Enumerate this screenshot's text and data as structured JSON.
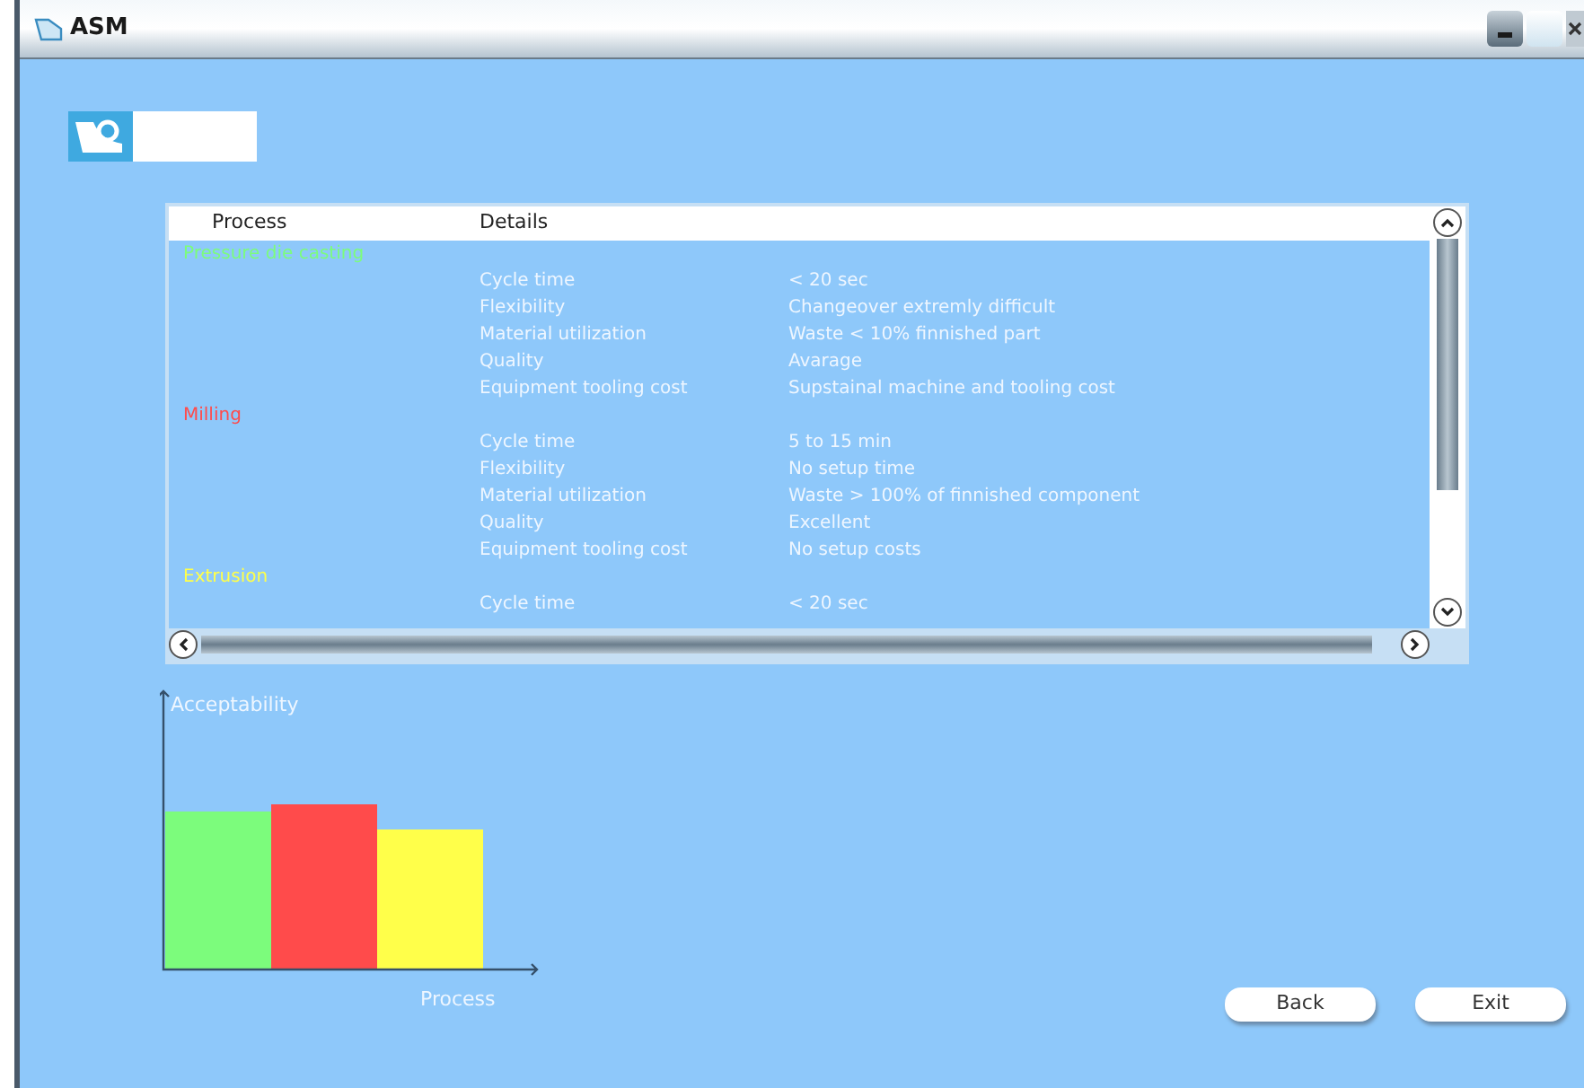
{
  "window": {
    "title": "ASM"
  },
  "table": {
    "columns": [
      "Process",
      "Details"
    ],
    "processes": [
      {
        "name": "Pressure die casting",
        "color": "#7cfc7c",
        "details": [
          {
            "label": "Cycle time",
            "value": "< 20 sec"
          },
          {
            "label": "Flexibility",
            "value": "Changeover extremly difficult"
          },
          {
            "label": "Material utilization",
            "value": "Waste < 10% finnished part"
          },
          {
            "label": "Quality",
            "value": "Avarage"
          },
          {
            "label": "Equipment tooling cost",
            "value": "Supstainal machine and tooling cost"
          }
        ]
      },
      {
        "name": "Milling",
        "color": "#ff4b4b",
        "details": [
          {
            "label": "Cycle time",
            "value": "5 to 15 min"
          },
          {
            "label": "Flexibility",
            "value": "No setup time"
          },
          {
            "label": "Material utilization",
            "value": "Waste > 100% of finnished component"
          },
          {
            "label": "Quality",
            "value": "Excellent"
          },
          {
            "label": "Equipment tooling cost",
            "value": "No setup costs"
          }
        ]
      },
      {
        "name": "Extrusion",
        "color": "#ffff4a",
        "details": [
          {
            "label": "Cycle time",
            "value": "< 20 sec"
          }
        ]
      }
    ]
  },
  "chart": {
    "ylabel": "Acceptability",
    "xlabel": "Process"
  },
  "buttons": [
    "Back",
    "Exit"
  ]
}
